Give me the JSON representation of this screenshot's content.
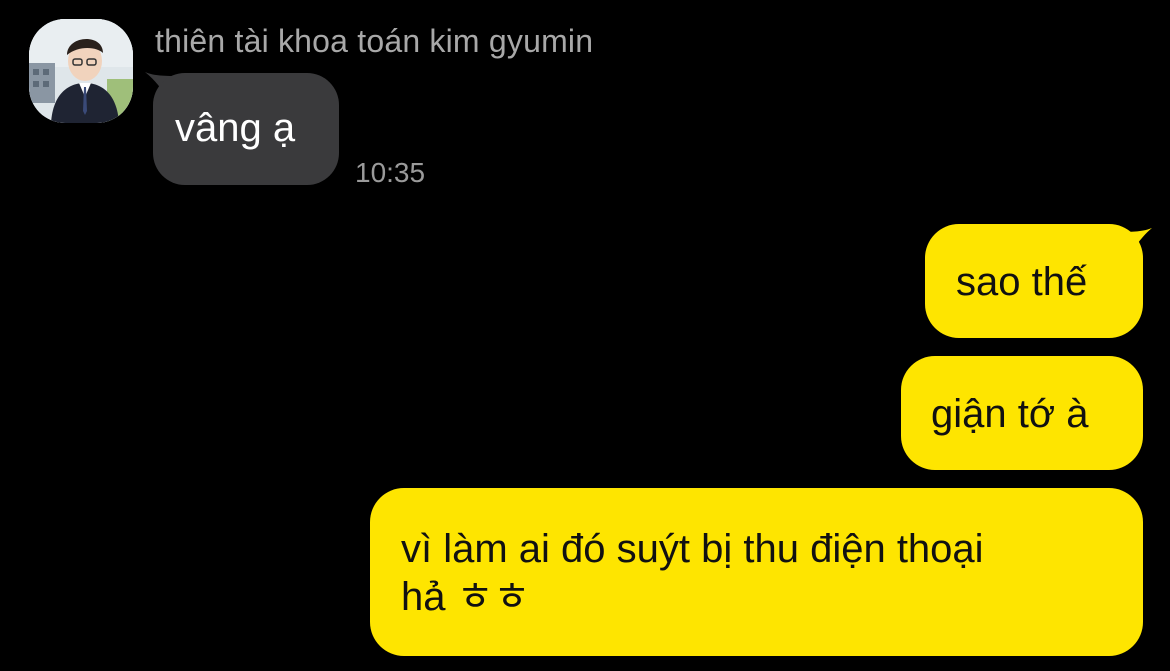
{
  "chat": {
    "contact": {
      "name": "thiên tài khoa toán kim gyumin"
    },
    "incoming": [
      {
        "text": "vâng ạ",
        "time": "10:35"
      }
    ],
    "outgoing": [
      {
        "text": "sao thế"
      },
      {
        "text": "giận tớ à"
      },
      {
        "lines": [
          "vì làm ai đó suýt bị thu điện thoại",
          "hả ㅎㅎ"
        ]
      }
    ]
  },
  "colors": {
    "background": "#000000",
    "incoming_bubble": "#3a3a3c",
    "outgoing_bubble": "#fee500",
    "name_text": "#a8a8a8",
    "time_text": "#9a9a9a"
  }
}
